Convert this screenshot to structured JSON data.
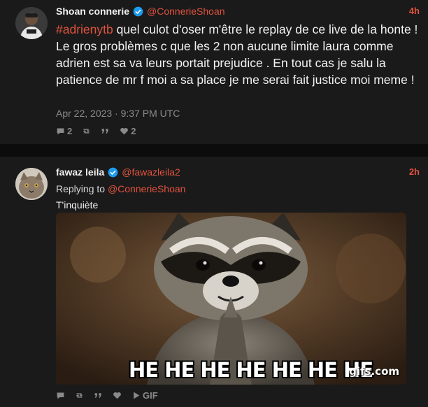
{
  "colors": {
    "accent": "#e0533e",
    "background": "#1a1a1a",
    "muted": "#8a8a8a",
    "verified": "#1d9bf0"
  },
  "tweets": [
    {
      "author": {
        "name": "Shoan connerie",
        "handle": "@ConnerieShoan",
        "verified": true
      },
      "time_ago": "4h",
      "hashtag": "#adrienytb",
      "text": " quel culot d'oser m'être le replay de ce live de la honte ! Le gros problèmes c que les 2 non aucune limite laura comme adrien est sa va leurs portait prejudice . En tout cas je salu la patience de mr f moi a sa place je me serai fait justice moi meme !",
      "date": "Apr 22, 2023 · 9:37 PM UTC",
      "stats": {
        "replies": "2",
        "likes": "2"
      }
    },
    {
      "author": {
        "name": "fawaz leila",
        "handle": "@fawazleila2",
        "verified": true
      },
      "time_ago": "2h",
      "replying_label": "Replying to",
      "replying_handle": "@ConnerieShoan",
      "text": "T'inquiète",
      "media": {
        "caption": "HE HE HE HE HE HE HE",
        "watermark": "gifs.com"
      },
      "stats": {
        "gif_label": "GIF"
      }
    }
  ]
}
